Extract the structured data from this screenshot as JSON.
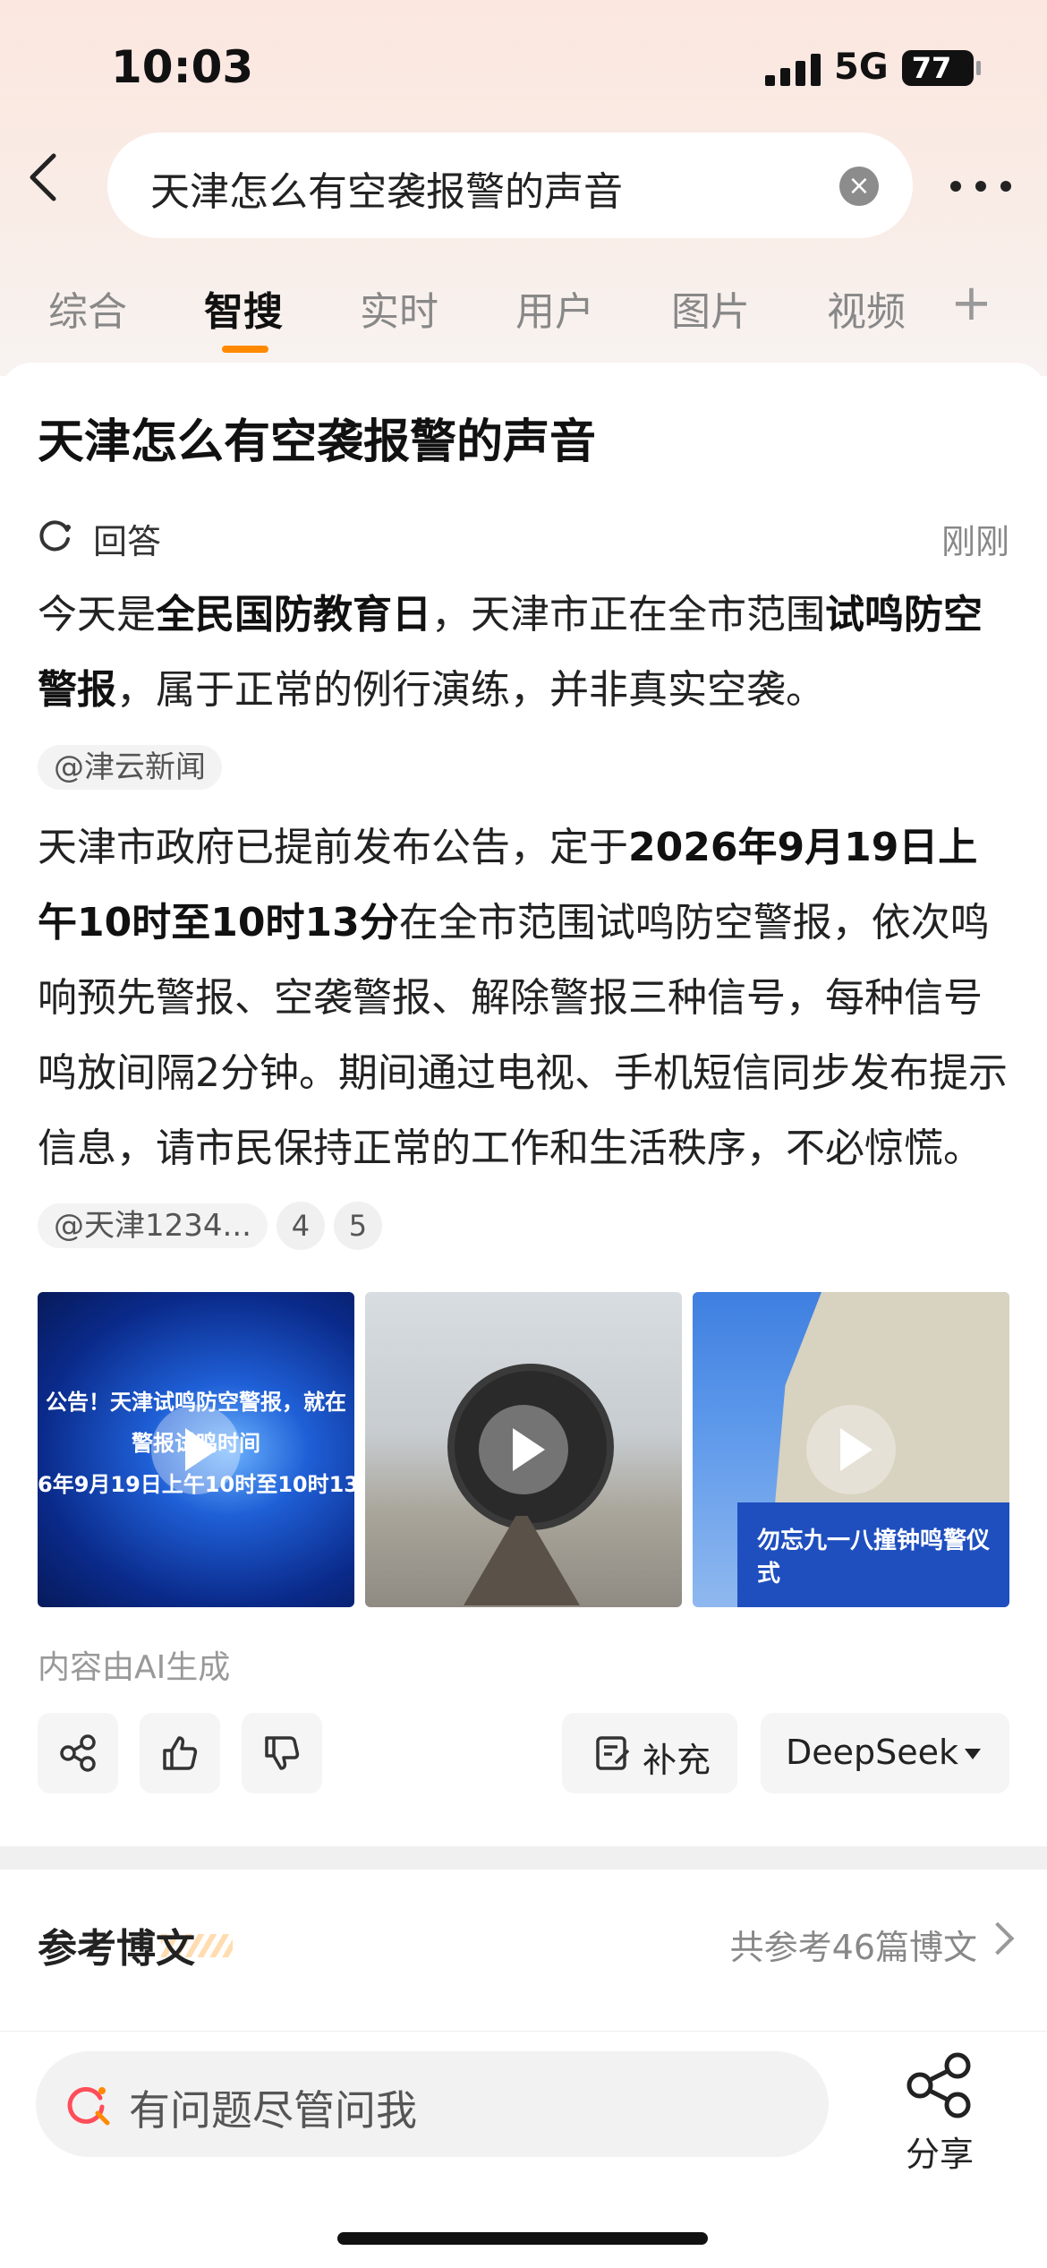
{
  "status_bar": {
    "time": "10:03",
    "network": "5G",
    "battery": "77"
  },
  "search": {
    "query": "天津怎么有空袭报警的声音",
    "clear_glyph": "×"
  },
  "tabs": [
    {
      "label": "综合",
      "active": false
    },
    {
      "label": "智搜",
      "active": true
    },
    {
      "label": "实时",
      "active": false
    },
    {
      "label": "用户",
      "active": false
    },
    {
      "label": "图片",
      "active": false
    },
    {
      "label": "视频",
      "active": false
    }
  ],
  "tab_plus": "+",
  "answer": {
    "question": "天津怎么有空袭报警的声音",
    "label": "回答",
    "time": "刚刚",
    "p1": {
      "t1": "今天是",
      "b1": "全民国防教育日",
      "t2": "，天津市正在全市范围",
      "b2": "试鸣防空警报",
      "t3": "，属于正常的例行演练，并非真实空袭。",
      "source": "@津云新闻"
    },
    "p2": {
      "t1": "天津市政府已提前发布公告，定于",
      "b1": "2026年9月19日上午10时至10时13分",
      "t2": "在全市范围试鸣防空警报，依次鸣响预先警报、空袭警报、解除警报三种信号，每种信号鸣放间隔2分钟。期间通过电视、手机短信同步发布提示信息，请市民保持正常的工作和生活秩序，不必惊慌。",
      "source": "@天津1234...",
      "refs": [
        "4",
        "5"
      ]
    },
    "videos": [
      {
        "banner_lines": [
          "公告！天津试鸣防空警报，就在",
          "警报试鸣时间",
          "6年9月19日上午10时至10时13"
        ]
      },
      {},
      {
        "panel_text": "勿忘九一八撞钟鸣警仪式",
        "icon": "play-icon"
      }
    ],
    "ai_note": "内容由AI生成",
    "supplement_label": "补充",
    "model_label": "DeepSeek"
  },
  "refs": {
    "title": "参考博文",
    "count_label": "共参考46篇博文"
  },
  "bottom": {
    "ask_placeholder": "有问题尽管问我",
    "share_label": "分享"
  },
  "colors": {
    "accent": "#ff8a00",
    "page_bg": "#ffffff",
    "top_gradient": "#fbe7df"
  }
}
